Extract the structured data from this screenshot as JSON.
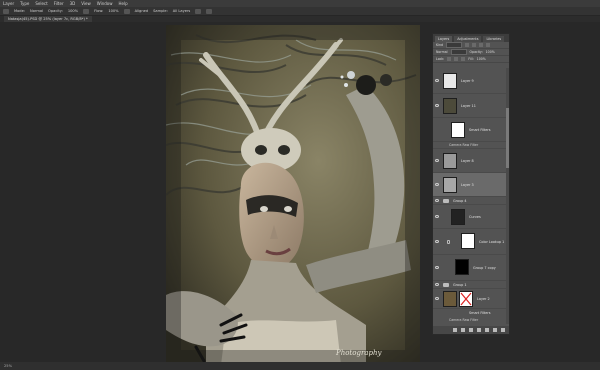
{
  "menubar": {
    "items": [
      "Layer",
      "Type",
      "Select",
      "Filter",
      "3D",
      "View",
      "Window",
      "Help"
    ]
  },
  "options": {
    "mode_label": "Mode:",
    "mode_value": "Normal",
    "opacity_label": "Opacity:",
    "opacity_value": "100%",
    "flow_label": "Flow:",
    "flow_value": "100%",
    "align_label": "Aligned",
    "sample_label": "Sample:",
    "sample_value": "All Layers"
  },
  "document_tab": {
    "title": "Natasja(45).PSD @ 25% (layer 7c, RGB/8*) *"
  },
  "status": {
    "zoom": "25%"
  },
  "photo": {
    "watermark": "Photography"
  },
  "layers_panel": {
    "tabs": [
      "Layers",
      "Adjustments",
      "Libraries"
    ],
    "kind_label": "Kind",
    "blend_label": "Normal",
    "opacity_label": "Opacity:",
    "opacity_value": "100%",
    "lock_label": "Lock:",
    "fill_label": "Fill:",
    "fill_value": "100%",
    "layers": [
      {
        "name": "Layer 9",
        "kind": "pixel",
        "thumb_color": "#e8e8e8"
      },
      {
        "name": "Layer 11",
        "kind": "pixel",
        "thumb_color": "#5a5a44"
      },
      {
        "name": "Smart Filters",
        "kind": "smart-filter"
      },
      {
        "name": "Camera Raw Filter",
        "kind": "filter-sub"
      },
      {
        "name": "Layer 8",
        "kind": "pixel",
        "thumb_color": "#9a9a9a"
      },
      {
        "name": "Layer 3",
        "kind": "pixel",
        "thumb_color": "#a8a8a8"
      },
      {
        "name": "Group 4",
        "kind": "group"
      },
      {
        "name": "Curves",
        "kind": "adjustment"
      },
      {
        "name": "Color Lookup 1",
        "kind": "adjustment"
      },
      {
        "name": "Group 7 copy",
        "kind": "mask"
      },
      {
        "name": "Group 1",
        "kind": "group"
      },
      {
        "name": "Layer 2",
        "kind": "pixel",
        "thumb_color": "#6b5a3a"
      },
      {
        "name": "Smart Filters",
        "kind": "smart-filter"
      },
      {
        "name": "Camera Raw Filter",
        "kind": "filter-sub"
      }
    ]
  },
  "icons": {
    "visibility": "eye-icon",
    "folder": "folder-icon",
    "link": "chain-icon"
  }
}
